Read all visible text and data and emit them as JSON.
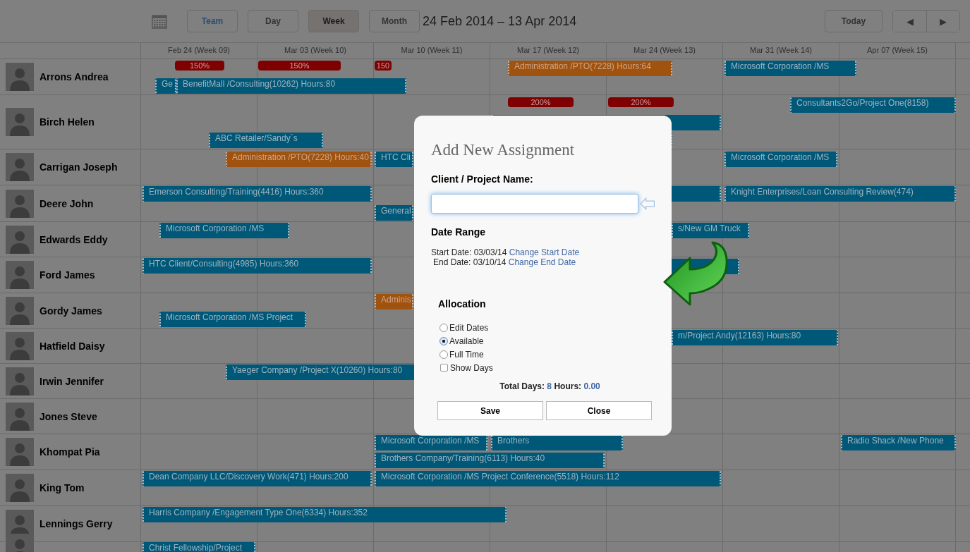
{
  "toolbar": {
    "team_button": "Team",
    "view_tabs": [
      {
        "label": "Day",
        "selected": false
      },
      {
        "label": "Week",
        "selected": true
      },
      {
        "label": "Month",
        "selected": false
      }
    ],
    "date_range": "24 Feb 2014 – 13 Apr 2014",
    "today_button": "Today",
    "prev_button": "◀",
    "next_button": "▶"
  },
  "weeks": [
    "Feb 24 (Week 09)",
    "Mar 03 (Week 10)",
    "Mar 10 (Week 11)",
    "Mar 17 (Week 12)",
    "Mar 24 (Week 13)",
    "Mar 31 (Week 14)",
    "Apr 07 (Week 15)"
  ],
  "people": [
    {
      "name": "Arrons Andrea",
      "assignments": [
        {
          "kind": "overload",
          "label": "150%"
        },
        {
          "kind": "overload",
          "label": "150%"
        },
        {
          "kind": "overload",
          "label": "150"
        },
        {
          "kind": "project",
          "label": "Ge"
        },
        {
          "kind": "project",
          "label": "BenefitMall /Consulting(10262) Hours:80"
        },
        {
          "kind": "pto",
          "label": "Administration /PTO(7228) Hours:64"
        },
        {
          "kind": "project",
          "label": "Microsoft Corporation /MS"
        }
      ]
    },
    {
      "name": "Birch Helen",
      "assignments": [
        {
          "kind": "overload",
          "label": "200%"
        },
        {
          "kind": "overload",
          "label": "200%"
        },
        {
          "kind": "project",
          "label": "Consultants2Go/Project One(8158)"
        },
        {
          "kind": "project"
        },
        {
          "kind": "project",
          "label": "ABC Retailer/Sandy`s"
        },
        {
          "kind": "project"
        }
      ]
    },
    {
      "name": "Carrigan Joseph",
      "assignments": [
        {
          "kind": "pto",
          "label": "Administration /PTO(7228) Hours:40"
        },
        {
          "kind": "project",
          "label": "HTC Cli"
        },
        {
          "kind": "project",
          "label": "Microsoft Corporation /MS"
        }
      ]
    },
    {
      "name": "Deere John",
      "assignments": [
        {
          "kind": "project",
          "label": "Emerson Consulting/Training(4416) Hours:360"
        },
        {
          "kind": "project",
          "label": "General"
        },
        {
          "kind": "project"
        },
        {
          "kind": "project",
          "label": "Knight Enterprises/Loan Consulting Review(474)"
        }
      ]
    },
    {
      "name": "Edwards Eddy",
      "assignments": [
        {
          "kind": "project",
          "label": "Microsoft Corporation /MS"
        },
        {
          "kind": "project",
          "label": "s/New GM Truck"
        }
      ]
    },
    {
      "name": "Ford James",
      "assignments": [
        {
          "kind": "project",
          "label": "HTC Client/Consulting(4985) Hours:360"
        },
        {
          "kind": "project"
        }
      ]
    },
    {
      "name": "Gordy James",
      "assignments": [
        {
          "kind": "pto",
          "label": "Adminis"
        },
        {
          "kind": "project",
          "label": "Microsoft Corporation /MS Project"
        }
      ]
    },
    {
      "name": "Hatfield Daisy",
      "assignments": [
        {
          "kind": "project",
          "label": "m/Project Andy(12163) Hours:80"
        }
      ]
    },
    {
      "name": "Irwin Jennifer",
      "assignments": [
        {
          "kind": "project",
          "label": "Yaeger Company /Project X(10260) Hours:80"
        }
      ]
    },
    {
      "name": "Jones Steve"
    },
    {
      "name": "Khompat Pia",
      "assignments": [
        {
          "kind": "project",
          "label": "Microsoft Corporation /MS"
        },
        {
          "kind": "project",
          "label": "Brothers"
        },
        {
          "kind": "project",
          "label": "Radio Shack /New Phone"
        },
        {
          "kind": "project",
          "label": "Brothers Company/Training(6113) Hours:40"
        }
      ]
    },
    {
      "name": "King Tom",
      "assignments": [
        {
          "kind": "project",
          "label": "Dean Company LLC/Discovery Work(471) Hours:200"
        },
        {
          "kind": "project",
          "label": "Microsoft Corporation /MS Project Conference(5518) Hours:112"
        }
      ]
    },
    {
      "name": "Lennings Gerry",
      "assignments": [
        {
          "kind": "project",
          "label": "Harris Company /Engagement Type One(6334) Hours:352"
        }
      ]
    },
    {
      "assignments": [
        {
          "kind": "project",
          "label": "Christ Fellowship/Project"
        }
      ]
    }
  ],
  "dialog": {
    "title": "Add New Assignment",
    "field_label": "Client / Project Name:",
    "date_heading": "Date Range",
    "start_text": "Start Date: 03/03/14",
    "start_link": "Change Start Date",
    "end_text": "End Date: 03/10/14",
    "end_link": "Change End Date",
    "allocation_heading": "Allocation",
    "options": [
      {
        "kind": "radio",
        "label": "Edit Dates",
        "selected": false
      },
      {
        "kind": "radio",
        "label": "Available",
        "selected": true
      },
      {
        "kind": "radio",
        "label": "Full Time",
        "selected": false
      },
      {
        "kind": "checkbox",
        "label": "Show Days",
        "checked": false
      }
    ],
    "totals": {
      "days_label": "Total Days:",
      "days": "8",
      "hours_label": "Hours:",
      "hours": "0.00"
    },
    "buttons": [
      "Save",
      "Close"
    ]
  }
}
